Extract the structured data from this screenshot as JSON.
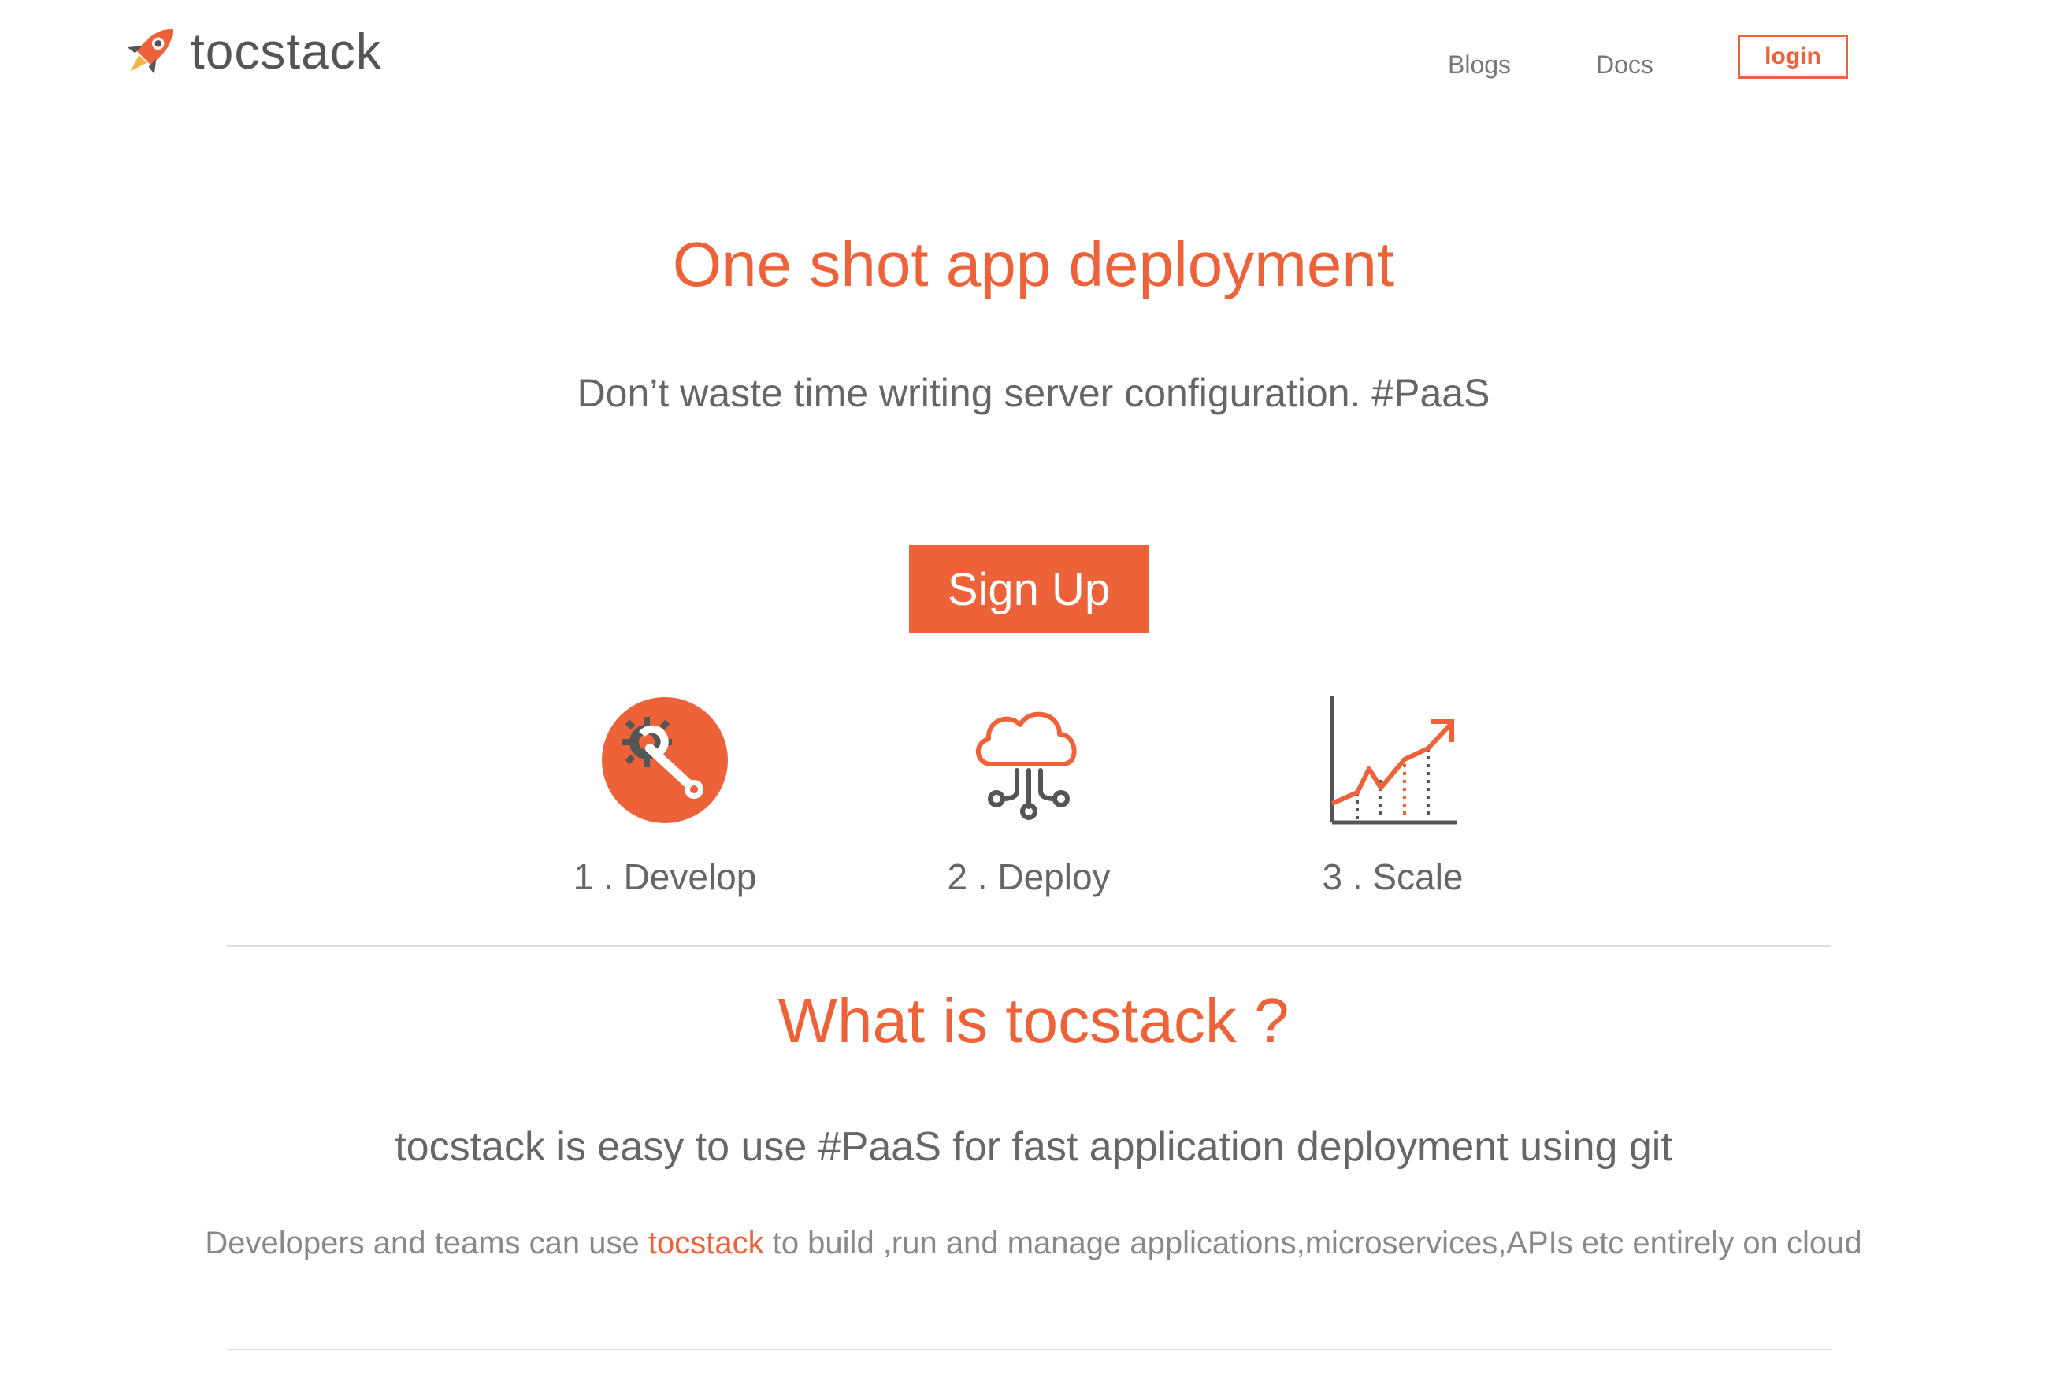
{
  "brand": {
    "name": "tocstack",
    "accent_color": "#ee6239"
  },
  "nav": {
    "blogs": "Blogs",
    "docs": "Docs",
    "login": "login"
  },
  "hero": {
    "title": "One shot app deployment",
    "subtitle": "Don’t waste time writing server configuration. #PaaS",
    "signup": "Sign Up"
  },
  "steps": [
    {
      "label": "1 . Develop",
      "icon": "wrench-gear-icon"
    },
    {
      "label": "2 . Deploy",
      "icon": "cloud-network-icon"
    },
    {
      "label": "3 . Scale",
      "icon": "growth-chart-icon"
    }
  ],
  "about": {
    "title": "What is tocstack ?",
    "subtitle": "tocstack is easy to use #PaaS for fast application deployment using git",
    "desc_before": "Developers and teams can use ",
    "desc_link": "tocstack",
    "desc_after": " to build ,run and manage applications,microservices,APIs etc entirely on cloud"
  }
}
